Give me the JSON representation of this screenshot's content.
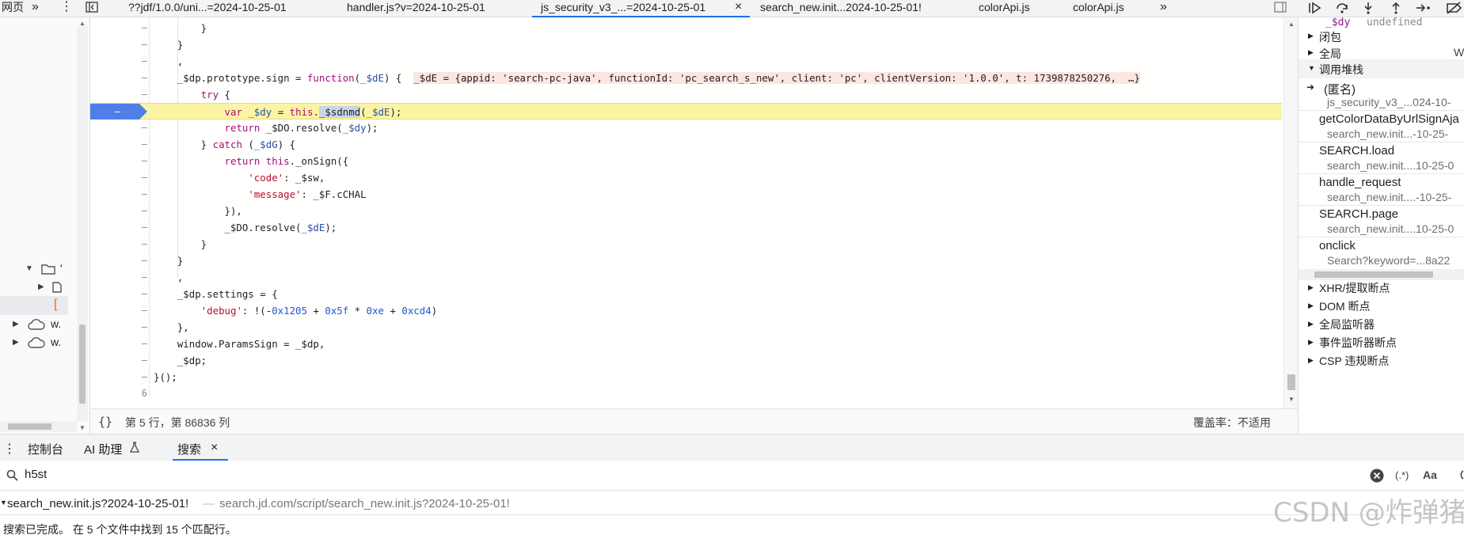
{
  "topbar": {
    "left_label": "网页",
    "overflow_left": "»",
    "more_menu": "⋮",
    "tabs": [
      {
        "label": "??jdf/1.0.0/uni...=2024-10-25-01"
      },
      {
        "label": "handler.js?v=2024-10-25-01"
      },
      {
        "label": "js_security_v3_...=2024-10-25-01"
      },
      {
        "label": "search_new.init...2024-10-25-01!"
      },
      {
        "label": "colorApi.js"
      },
      {
        "label": "colorApi.js"
      }
    ],
    "active_tab_close": "×",
    "overflow_right": "»"
  },
  "navigator": {
    "items": [
      {
        "label": "'"
      },
      {
        "label": "w."
      },
      {
        "label": "w."
      }
    ]
  },
  "editor": {
    "breakpoint_line": "–",
    "gutter_dash": "–",
    "last_line_number": "6",
    "inline_value": "_$dE = {appid: 'search-pc-java', functionId: 'pc_search_s_new', client: 'pc', clientVersion: '1.0.0', t: 1739878250276,  …}"
  },
  "statusbar": {
    "braces": "{}",
    "position": "第 5 行，第 86836 列",
    "coverage": "覆盖率：不适用"
  },
  "sidebar": {
    "scope_var_name": "_$dy",
    "scope_var_value": "undefined",
    "scope_items": [
      "闭包",
      "全局"
    ],
    "global_value": "Wi",
    "callstack_header": "调用堆栈",
    "frames": [
      {
        "name": "(匿名)",
        "location": "js_security_v3_...024-10-"
      },
      {
        "name": "getColorDataByUrlSignAja",
        "location": "search_new.init...-10-25-"
      },
      {
        "name": "SEARCH.load",
        "location": "search_new.init....10-25-0"
      },
      {
        "name": "handle_request",
        "location": "search_new.init....-10-25-"
      },
      {
        "name": "SEARCH.page",
        "location": "search_new.init....10-25-0"
      },
      {
        "name": "onclick",
        "location": "Search?keyword=...8a22"
      }
    ],
    "breakpoint_sections": [
      "XHR/提取断点",
      "DOM 断点",
      "全局监听器",
      "事件监听器断点",
      "CSP 违规断点"
    ]
  },
  "drawer": {
    "tabs": [
      {
        "label": "控制台"
      },
      {
        "label": "AI 助理"
      },
      {
        "label": "搜索"
      }
    ],
    "search_query": "h5st",
    "regex_toggle": "(.*)",
    "case_toggle": "Aa",
    "result_file": "search_new.init.js?2024-10-25-01!",
    "result_path": "search.jd.com/script/search_new.init.js?2024-10-25-01!",
    "status": "搜索已完成。 在 5 个文件中找到 15 个匹配行。"
  },
  "watermark": "CSDN @炸弹猪",
  "colors": {
    "accent": "#1a73e8",
    "breakpoint": "#4f7ee8",
    "paused_line": "#fbf4a5"
  }
}
